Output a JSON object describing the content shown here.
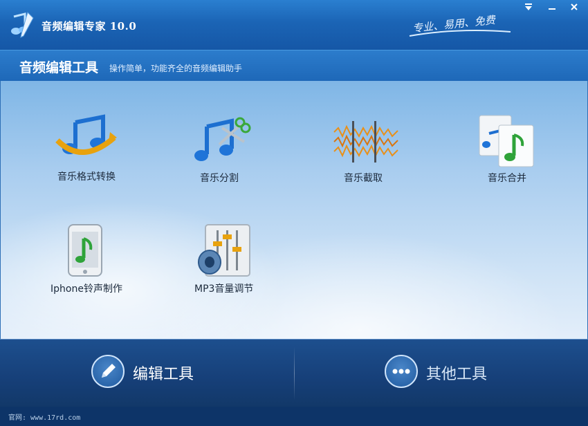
{
  "titlebar": {
    "app_title": "音频编辑专家 10.0",
    "slogan": "专业、易用、免费",
    "controls": [
      "menu",
      "minimize",
      "close"
    ]
  },
  "header": {
    "title": "音频编辑工具",
    "subtitle": "操作简单，功能齐全的音频编辑助手"
  },
  "tools": [
    {
      "label": "音乐格式转换",
      "icon": "music-convert-icon"
    },
    {
      "label": "音乐分割",
      "icon": "music-scissors-icon"
    },
    {
      "label": "音乐截取",
      "icon": "waveform-cut-icon"
    },
    {
      "label": "音乐合并",
      "icon": "music-merge-icon"
    },
    {
      "label": "Iphone铃声制作",
      "icon": "iphone-ringtone-icon"
    },
    {
      "label": "MP3音量调节",
      "icon": "volume-mixer-icon"
    }
  ],
  "bottom_nav": {
    "edit_tools": "编辑工具",
    "other_tools": "其他工具",
    "active": "edit_tools"
  },
  "footer": {
    "website": "官网: www.17rd.com"
  },
  "colors": {
    "title_bar": "#1b64b5",
    "content_bg": "#cfe3f6",
    "bottom_bar": "#163f78",
    "active_tab_text": "#ffffff",
    "inactive_tab_text": "#d9e8f8"
  }
}
